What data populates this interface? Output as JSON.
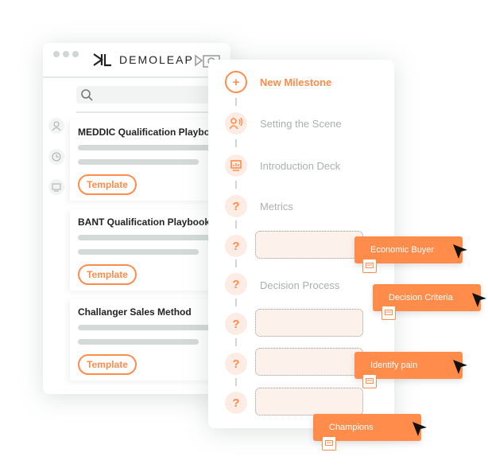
{
  "app": {
    "logo_text": "DEMOLEAP"
  },
  "cards": [
    {
      "title": "MEDDIC Qualification Playbook",
      "button": "Template"
    },
    {
      "title": "BANT Qualification Playbook",
      "button": "Template"
    },
    {
      "title": "Challanger Sales Method",
      "button": "Template"
    }
  ],
  "milestones": {
    "new": "New Milestone",
    "items": [
      "Setting the Scene",
      "Introduction Deck",
      "Metrics",
      "Decision Process"
    ]
  },
  "tags": [
    "Economic Buyer",
    "Decision Criteria",
    "Identify pain",
    "Champions"
  ],
  "colors": {
    "accent": "#ff8c4b",
    "muted": "#a9b1ae"
  }
}
